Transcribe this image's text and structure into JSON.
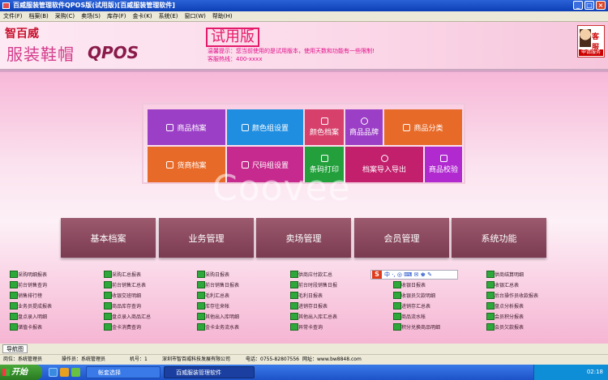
{
  "window": {
    "title": "百威服装管理软件QPOS版(试用版)[百威服装管理软件]",
    "controls": [
      "_",
      "□",
      "×"
    ]
  },
  "menu": [
    "文件(F)",
    "档案(B)",
    "采购(C)",
    "卖场(S)",
    "库存(F)",
    "金卡(K)",
    "系统(E)",
    "窗口(W)",
    "帮助(H)"
  ],
  "header": {
    "logo_brand": "智百威",
    "logo_product": "服装鞋帽",
    "logo_pos": "QPOS",
    "trial": "试用版",
    "tip1": "温馨提示：您当前使用的是试用版本，使用天数和功能有一些限制!",
    "tip2": "客服热线：400-xxxx",
    "kefu": "客服",
    "kefu_btn": "申请服务"
  },
  "tiles": [
    {
      "label": "商品档案",
      "color": "#9b3fc6"
    },
    {
      "label": "颜色组设置",
      "color": "#1f8de0"
    },
    {
      "label": "颜色档案",
      "color": "#d6406a"
    },
    {
      "label": "商品品牌",
      "color": "#9b3fc6"
    },
    {
      "label": "商品分类",
      "color": "#e86a28"
    },
    {
      "label": "货商档案",
      "color": "#e86a28"
    },
    {
      "label": "尺码组设置",
      "color": "#c62a8e"
    },
    {
      "label": "条码打印",
      "color": "#23a03c"
    },
    {
      "label": "档案导入导出",
      "color": "#c21f6c"
    },
    {
      "label": "商品校验",
      "color": "#b02ad0"
    }
  ],
  "modules": [
    "基本档案",
    "业务管理",
    "卖场管理",
    "会员管理",
    "系统功能"
  ],
  "links": [
    [
      "采购明细报表",
      "前台销售查询",
      "销售排行榜",
      "业务员提成报表",
      "盘点录入明细",
      "储值卡报表"
    ],
    [
      "采购汇总报表",
      "前台销售汇总表",
      "收银交班明细",
      "商品库存查询",
      "盘点录入商品汇总",
      "金卡消费查询"
    ],
    [
      "采购日报表",
      "前台销售日报表",
      "毛利汇总表",
      "库存往来帐",
      "其他出入库明细",
      "金卡业务流水表"
    ],
    [
      "供商应付款汇总",
      "前台时段销售日报",
      "毛利日报表",
      "进销存日报表",
      "其他出入库汇总表",
      "异常卡查询"
    ],
    [
      "",
      "收银日报表",
      "收银员欠款明细",
      "进销存汇总表",
      "商品流水帐",
      "积分兑换商品明细"
    ],
    [
      "供商结算明细",
      "收银汇总表",
      "后台操作员收款报表",
      "盘点分析报表",
      "会员积分报表",
      "会员欠款报表"
    ]
  ],
  "ime": {
    "s": "S",
    "glyphs": "中 ·, ◎ ⌨ ✉ ♚ ✎"
  },
  "watermark": "Coovee",
  "status": {
    "nav": "导航图",
    "post": "岗位：系统管理员",
    "operator": "操作员：系统管理员",
    "machine": "机号：1",
    "company": "深圳市智百威科技发展有限公司",
    "phone": "电话：0755-82807556",
    "site": "网址：www.bw8848.com"
  },
  "taskbar": {
    "start": "开始",
    "items": [
      "帐套选择",
      "百威服装管理软件"
    ],
    "time": "02:18"
  }
}
